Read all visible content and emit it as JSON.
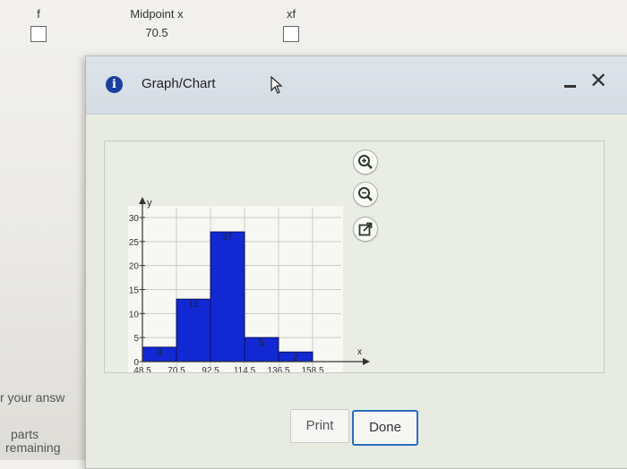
{
  "worksheet": {
    "columns": [
      "f",
      "Midpoint x",
      "xf"
    ],
    "midpoint_value": "70.5",
    "side_text_1": "r your answ",
    "side_text_2": "parts",
    "side_text_3": "remaining"
  },
  "dialog": {
    "title": "Graph/Chart",
    "info_icon": "info-icon",
    "minimize_icon": "minimize-icon",
    "close_icon": "close-icon",
    "tools": [
      "zoom-in-icon",
      "zoom-out-icon",
      "external-link-icon"
    ],
    "print_label": "Print",
    "done_label": "Done"
  },
  "colors": {
    "bar_fill": "#1228d2",
    "accent": "#2a6fb8",
    "info": "#1b3fa0"
  },
  "chart_data": {
    "type": "bar",
    "histogram": true,
    "xlabel": "x",
    "ylabel": "y",
    "x_ticks": [
      "48.5",
      "70.5",
      "92.5",
      "114.5",
      "136.5",
      "158.5"
    ],
    "y_ticks": [
      "0",
      "5",
      "10",
      "15",
      "20",
      "25",
      "30"
    ],
    "ylim": [
      0,
      30
    ],
    "bins": [
      {
        "from": 48.5,
        "to": 70.5,
        "value": 3
      },
      {
        "from": 70.5,
        "to": 92.5,
        "value": 13
      },
      {
        "from": 92.5,
        "to": 114.5,
        "value": 27
      },
      {
        "from": 114.5,
        "to": 136.5,
        "value": 5
      },
      {
        "from": 136.5,
        "to": 158.5,
        "value": 2
      }
    ],
    "grid": true
  }
}
